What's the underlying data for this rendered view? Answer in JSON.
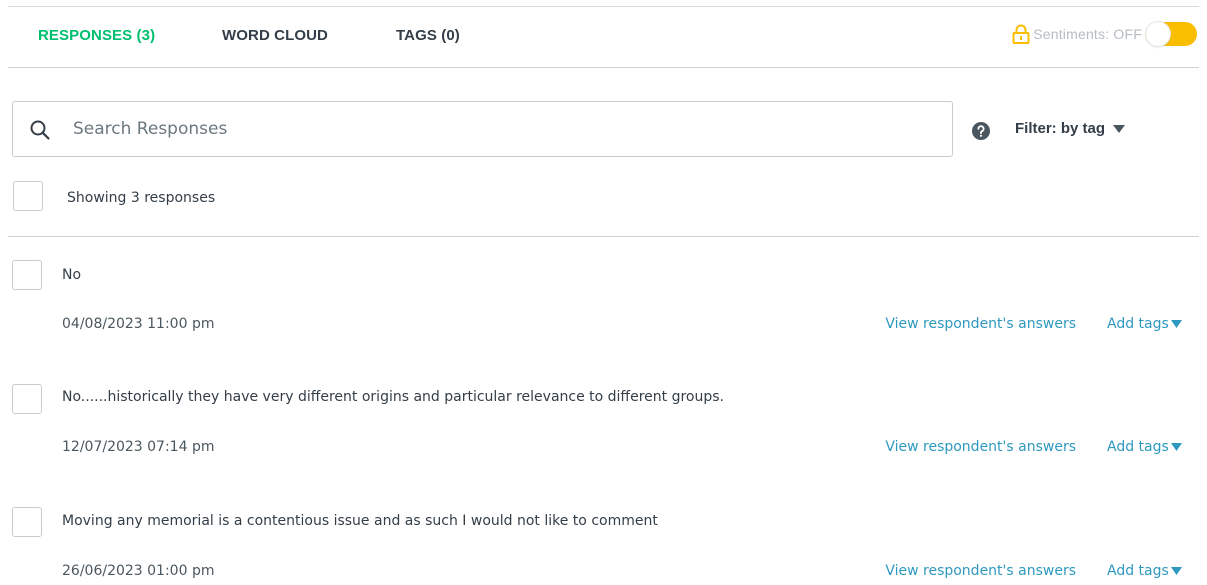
{
  "tabs": {
    "responses": "RESPONSES (3)",
    "word_cloud": "WORD CLOUD",
    "tags": "TAGS (0)",
    "active_color": "#00bf6f"
  },
  "sentiments": {
    "label": "Sentiments: OFF",
    "toggle_color": "#f9be00",
    "lock_color": "#f9be00",
    "icon": "lock-icon"
  },
  "search": {
    "placeholder": "Search Responses",
    "value": "",
    "icon": "search-icon"
  },
  "filter": {
    "help_icon": "question-circle-icon",
    "label": "Filter: by tag",
    "caret_icon": "caret-down-icon"
  },
  "summary": {
    "showing": "Showing 3 responses"
  },
  "responses": [
    {
      "text": "No",
      "date": "04/08/2023 11:00 pm",
      "view_link": "View respondent's answers",
      "add_tags": "Add tags"
    },
    {
      "text": "No......historically they have very different origins and particular relevance to different groups.",
      "date": "12/07/2023 07:14 pm",
      "view_link": "View respondent's answers",
      "add_tags": "Add tags"
    },
    {
      "text": "Moving any memorial is a contentious issue and as such I would not like to comment",
      "date": "26/06/2023 01:00 pm",
      "view_link": "View respondent's answers",
      "add_tags": "Add tags"
    }
  ],
  "colors": {
    "link": "#2e99bf",
    "text": "#333e48",
    "border": "#c9ccd0"
  }
}
